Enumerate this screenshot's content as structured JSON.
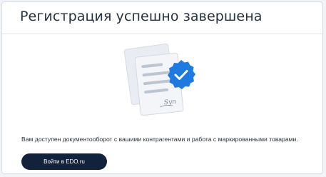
{
  "page": {
    "title": "Регистрация успешно завершена",
    "message": "Вам доступен документооборот с вашими контрагентами и работа с маркированными товарами.",
    "login_button_label": "Войти в EDO.ru"
  },
  "illustration": {
    "icon": "documents-signed-icon",
    "badge_icon": "check-badge-icon",
    "signature_text": "Syn"
  },
  "colors": {
    "title_text": "#27313f",
    "button_bg": "#13223b",
    "badge": "#1f7ae0",
    "paper": "#edf0f5",
    "paper_lines": "#bcc5d2"
  }
}
